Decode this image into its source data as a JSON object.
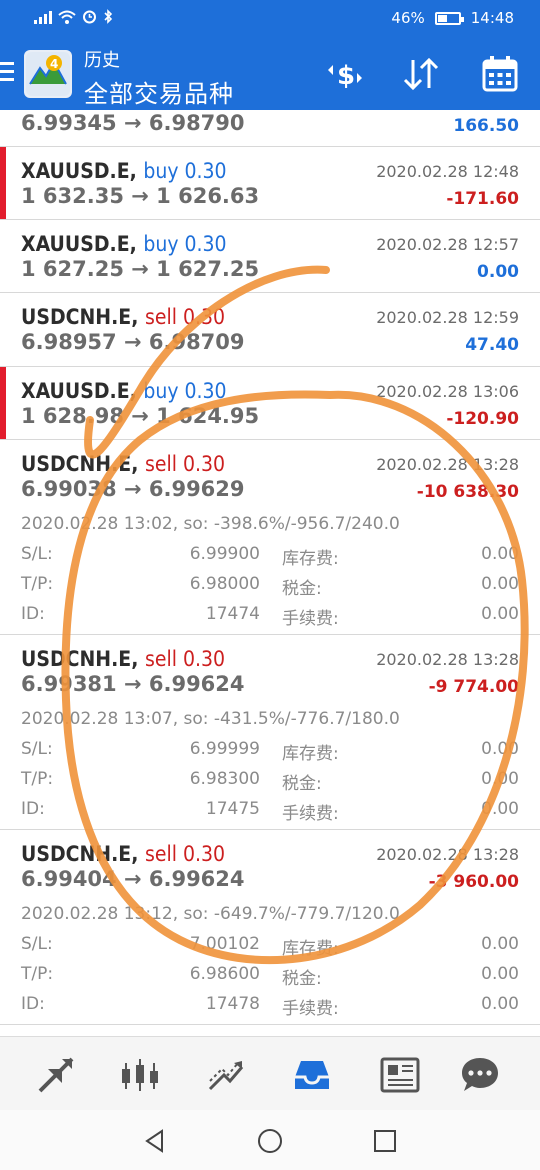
{
  "status_bar": {
    "battery": "46%",
    "battery_level": 0.46,
    "clock": "14:48"
  },
  "header": {
    "subtitle": "历史",
    "title": "全部交易品种"
  },
  "colors": {
    "header_bg": "#1e6fd9",
    "buy": "#1e6fd9",
    "sell": "#cc1f1f",
    "marker_red": "#e21d2d",
    "annotation": "#f0923a"
  },
  "rows": [
    {
      "prices": "6.99345 → 6.98790",
      "profit": "166.50"
    },
    {
      "symbol": "XAUUSD.E,",
      "side": "buy 0.30",
      "time": "2020.02.28 12:48",
      "prices": "1 632.35 → 1 626.63",
      "profit": "-171.60"
    },
    {
      "symbol": "XAUUSD.E,",
      "side": "buy 0.30",
      "time": "2020.02.28 12:57",
      "prices": "1 627.25 → 1 627.25",
      "profit": "0.00"
    },
    {
      "symbol": "USDCNH.E,",
      "side": "sell 0.30",
      "time": "2020.02.28 12:59",
      "prices": "6.98957 → 6.98709",
      "profit": "47.40"
    },
    {
      "symbol": "XAUUSD.E,",
      "side": "buy 0.30",
      "time": "2020.02.28 13:06",
      "prices": "1 628.98 → 1 624.95",
      "profit": "-120.90"
    },
    {
      "symbol": "USDCNH.E,",
      "side": "sell 0.30",
      "time": "2020.02.28 13:28",
      "prices": "6.99038 → 6.99629",
      "profit": "-10 638.30",
      "detail": "2020.02.28 13:02, so: -398.6%/-956.7/240.0",
      "sl_label": "S/L:",
      "sl": "6.99900",
      "tp_label": "T/P:",
      "tp": "6.98000",
      "id_label": "ID:",
      "id": "17474",
      "swap_label": "库存费:",
      "swap": "0.00",
      "tax_label": "税金:",
      "tax": "0.00",
      "fee_label": "手续费:",
      "fee": "0.00"
    },
    {
      "symbol": "USDCNH.E,",
      "side": "sell 0.30",
      "time": "2020.02.28 13:28",
      "prices": "6.99381 → 6.99624",
      "profit": "-9 774.00",
      "detail": "2020.02.28 13:07, so: -431.5%/-776.7/180.0",
      "sl_label": "S/L:",
      "sl": "6.99999",
      "tp_label": "T/P:",
      "tp": "6.98300",
      "id_label": "ID:",
      "id": "17475",
      "swap_label": "库存费:",
      "swap": "0.00",
      "tax_label": "税金:",
      "tax": "0.00",
      "fee_label": "手续费:",
      "fee": "0.00"
    },
    {
      "symbol": "USDCNH.E,",
      "side": "sell 0.30",
      "time": "2020.02.28 13:28",
      "prices": "6.99404 → 6.99624",
      "profit": "-3 960.00",
      "detail": "2020.02.28 13:12, so: -649.7%/-779.7/120.0",
      "sl_label": "S/L:",
      "sl": "7.00102",
      "tp_label": "T/P:",
      "tp": "6.98600",
      "id_label": "ID:",
      "id": "17478",
      "swap_label": "库存费:",
      "swap": "0.00",
      "tax_label": "税金:",
      "tax": "0.00",
      "fee_label": "手续费:",
      "fee": "0.00"
    }
  ],
  "bottom_nav": [
    {
      "icon": "quotes-arrows-icon"
    },
    {
      "icon": "candlestick-chart-icon"
    },
    {
      "icon": "trade-chart-icon"
    },
    {
      "icon": "history-inbox-icon",
      "active": true
    },
    {
      "icon": "news-icon"
    },
    {
      "icon": "chat-icon"
    }
  ],
  "system_nav": [
    {
      "icon": "back-icon"
    },
    {
      "icon": "home-icon"
    },
    {
      "icon": "recents-icon"
    }
  ]
}
